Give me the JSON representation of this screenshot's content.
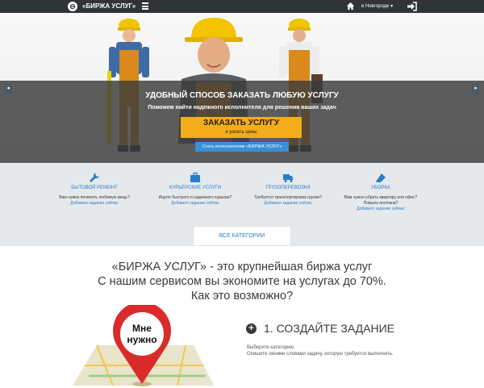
{
  "topbar": {
    "title": "«БИРЖА УСЛУГ»",
    "city": "в Новгороде ▾"
  },
  "hero": {
    "title": "УДОБНЫЙ СПОСОБ ЗАКАЗАТЬ ЛЮБУЮ УСЛУГУ",
    "subtitle": "Поможем найти надежного исполнителя для решения ваших задач",
    "cta_label": "ЗАКАЗАТЬ УСЛУГУ",
    "cta_sub": "и узнать цены",
    "exec_label": "Стать исполнителем «БИРЖА УСЛУГ»",
    "prev_icon": "chevron-left-icon",
    "next_icon": "chevron-right-icon"
  },
  "services": [
    {
      "title": "БЫТОВОЙ РЕМОНТ",
      "question": "Вам нужно починить любимую вещь?",
      "link": "Добавьте задание сейчас",
      "icon": "wrench-icon"
    },
    {
      "title": "КУРЬЕРСКИЕ УСЛУГИ",
      "question": "Ищете быстрого и надежного курьера?",
      "link": "Добавьте задание сейчас",
      "icon": "briefcase-icon"
    },
    {
      "title": "ГРУЗОПЕРЕВОЗКИ",
      "question": "Требуется транспортировка грузов?",
      "link": "Добавьте задание сейчас",
      "icon": "truck-icon"
    },
    {
      "title": "УБОРКА",
      "question": "Вам нужно убрать квартиру или офис?",
      "question2": "Помыть пол/окна?",
      "link": "Добавьте задание сейчас",
      "icon": "eraser-icon"
    }
  ],
  "categories_button": "ВСЕ КАТЕГОРИИ",
  "intro": {
    "line1": "«БИРЖА УСЛУГ» - это крупнейшая биржа услуг",
    "line2": "С нашим сервисом вы экономите на услугах до 70%.",
    "line3": "Как это возможно?"
  },
  "pin_text_line1": "Мне",
  "pin_text_line2": "нужно",
  "step": {
    "title": "1. СОЗДАЙТЕ ЗАДАНИЕ",
    "desc1": "Выберите категорию.",
    "desc2": "Опишите своими словами задачу, которую требуется выполнить."
  },
  "colors": {
    "accent_blue": "#2a7cc7",
    "cta_orange": "#f3ad1a",
    "topbar": "#2f3437",
    "pin_red": "#d92b2b"
  }
}
